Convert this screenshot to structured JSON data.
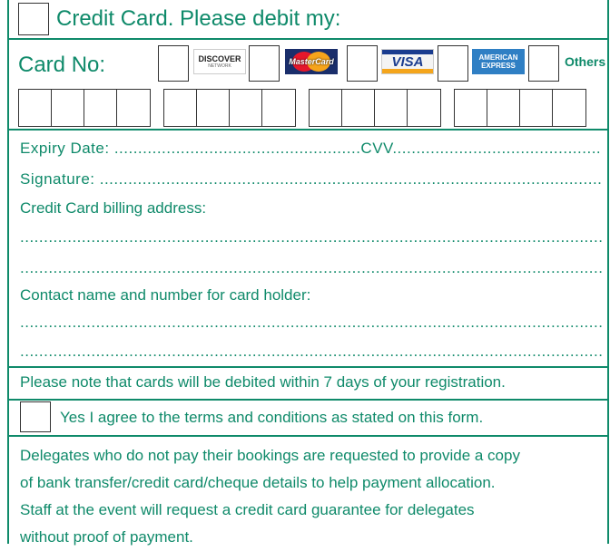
{
  "header": {
    "title": "Credit Card. Please debit my:"
  },
  "card_row": {
    "label": "Card No:",
    "logos": [
      "DISCOVER",
      "MasterCard",
      "VISA",
      "AMERICAN EXPRESS"
    ],
    "discover_sub": "NETWORK",
    "amex_line1": "AMERICAN",
    "amex_line2": "EXPRESS",
    "others": "Others"
  },
  "fields": {
    "expiry_label": "Expiry Date: ",
    "cvv_label": "CVV",
    "signature_label": "Signature: ",
    "billing_label": "Credit Card billing address:",
    "contact_label": "Contact name and number for card holder:"
  },
  "notes": {
    "debit_note": "Please note that cards will be debited within 7 days of your registration.",
    "agree_text": "Yes I agree to the terms and conditions as stated on this form."
  },
  "footer": {
    "line1": "Delegates who do not pay their bookings are requested to provide a copy",
    "line2": "of bank transfer/credit card/cheque details to help payment allocation.",
    "line3": "Staff at the event will request a credit card guarantee for delegates",
    "line4": "without proof of payment."
  },
  "colors": {
    "accent": "#0f8a6a"
  }
}
